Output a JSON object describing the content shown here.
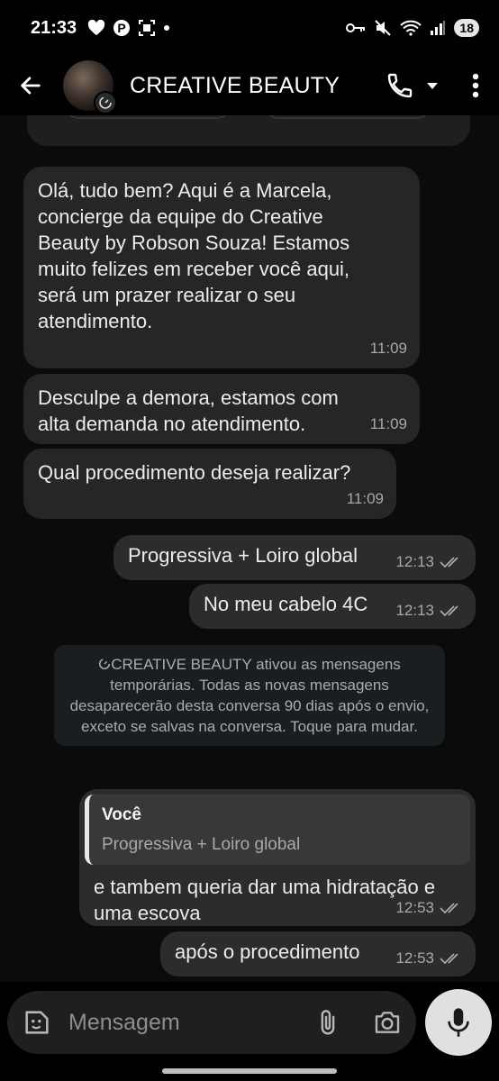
{
  "status": {
    "time": "21:33",
    "battery": "18"
  },
  "header": {
    "title": "CREATIVE BEAUTY"
  },
  "messages": [
    {
      "dir": "in",
      "text": "Olá, tudo bem? Aqui é a Marcela, concierge da equipe do Creative Beauty by Robson Souza! Estamos muito felizes em receber você aqui, será um prazer realizar o seu atendimento.",
      "time": "11:09"
    },
    {
      "dir": "in",
      "text": "Desculpe a demora, estamos com alta demanda no atendimento.",
      "time": "11:09"
    },
    {
      "dir": "in",
      "text": "Qual procedimento deseja realizar?",
      "time": "11:09"
    },
    {
      "dir": "out",
      "text": "Progressiva + Loiro global",
      "time": "12:13"
    },
    {
      "dir": "out",
      "text": "No meu cabelo 4C",
      "time": "12:13"
    },
    {
      "dir": "out",
      "quote_name": "Você",
      "quote_text": "Progressiva + Loiro global",
      "text": "e tambem queria dar uma hidratação e uma escova",
      "time": "12:53"
    },
    {
      "dir": "out",
      "text": "após o procedimento",
      "time": "12:53"
    }
  ],
  "system_notice": "CREATIVE BEAUTY ativou as mensagens temporárias. Todas as novas mensagens desaparecerão desta conversa 90 dias após o envio, exceto se salvas na conversa. Toque para mudar.",
  "composer": {
    "placeholder": "Mensagem"
  },
  "colors": {
    "background": "#0b0b0b",
    "bubble_in": "#262626",
    "bubble_out": "#2c2c2c",
    "mic_button": "#e0e0e0"
  }
}
